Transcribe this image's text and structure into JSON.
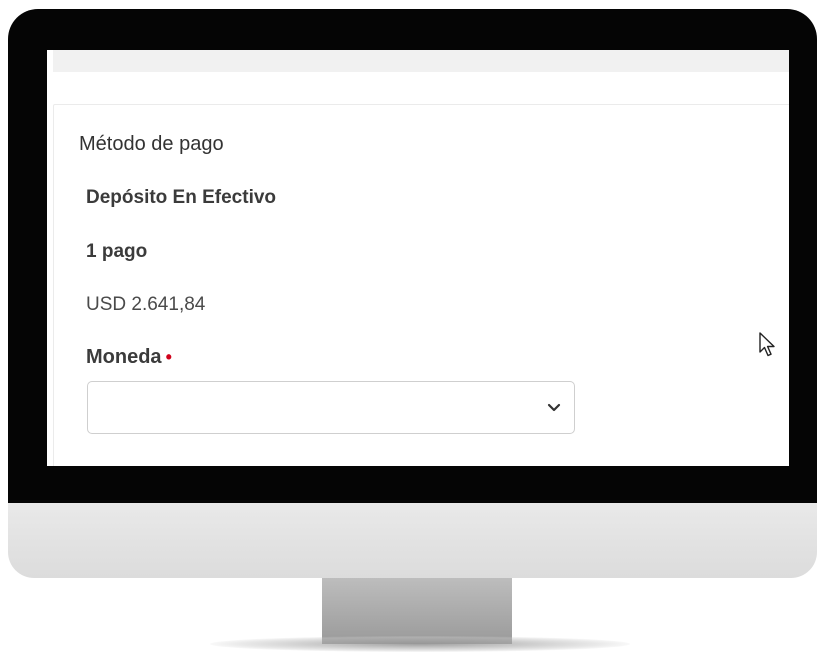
{
  "payment": {
    "section_title": "Método de pago",
    "method_name": "Depósito En Efectivo",
    "installments": "1 pago",
    "amount": "USD 2.641,84"
  },
  "currency_field": {
    "label": "Moneda",
    "required_mark": "•",
    "selected_value": ""
  },
  "colors": {
    "required": "#d0021b",
    "text": "#3b3b3b",
    "bezel": "#050505"
  },
  "icons": {
    "select_chevron": "chevron-down-icon",
    "pointer": "mouse-cursor-icon"
  }
}
